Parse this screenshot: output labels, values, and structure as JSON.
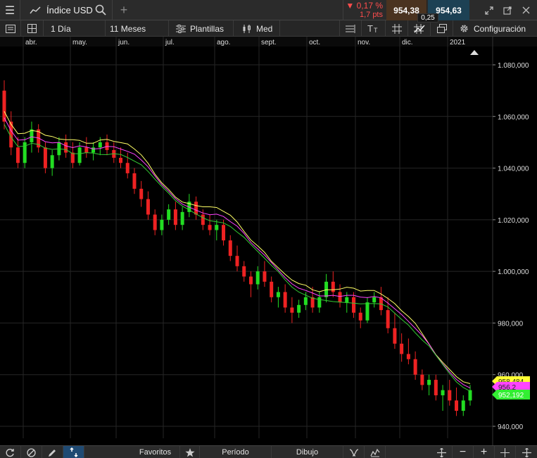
{
  "topbar": {
    "instrument": "Índice USD",
    "change_pct": "▼ 0,17 %",
    "change_pts": "1,7 pts",
    "bid": "954,38",
    "ask": "954,63",
    "spread": "0,25",
    "icons": [
      "menu-icon",
      "line-chart-icon",
      "search-icon",
      "plus-icon",
      "expand-icon",
      "popout-icon",
      "close-icon"
    ]
  },
  "toolbar": {
    "interval": "1 Día",
    "range": "11 Meses",
    "templates": "Plantillas",
    "price_type": "Med",
    "settings": "Configuración",
    "icons": [
      "panel-icon",
      "layout-icon",
      "templates-icon",
      "candles-icon",
      "indicators-icon",
      "text-size-icon",
      "grid-icon",
      "drawing-icon",
      "window-icon",
      "gear-icon"
    ]
  },
  "chart_data": {
    "type": "candlestick",
    "x_axis": [
      "abr.",
      "may.",
      "jun.",
      "jul.",
      "ago.",
      "sept.",
      "oct.",
      "nov.",
      "dic.",
      "2021"
    ],
    "y_ticks": [
      "1.080,000",
      "1.060,000",
      "1.040,000",
      "1.020,000",
      "1.000,000",
      "980,000",
      "960,000",
      "940,000"
    ],
    "ylim": [
      935,
      1085
    ],
    "price_labels": [
      {
        "text": "958,484",
        "color": "#ffff33"
      },
      {
        "text": "956,2",
        "color": "#ff44ff"
      },
      {
        "text": "952,192",
        "color": "#33ee33"
      }
    ],
    "colors": {
      "up": "#22dd22",
      "down": "#ee2222",
      "ma_fast": "#ffff66",
      "ma_mid": "#ff44ff",
      "ma_slow": "#33cc33"
    },
    "candles": [
      [
        1070,
        1074,
        1055,
        1058
      ],
      [
        1058,
        1062,
        1045,
        1048
      ],
      [
        1048,
        1052,
        1040,
        1042
      ],
      [
        1042,
        1052,
        1040,
        1050
      ],
      [
        1050,
        1058,
        1046,
        1055
      ],
      [
        1055,
        1057,
        1046,
        1048
      ],
      [
        1048,
        1050,
        1038,
        1040
      ],
      [
        1040,
        1047,
        1037,
        1045
      ],
      [
        1045,
        1052,
        1043,
        1050
      ],
      [
        1050,
        1053,
        1044,
        1046
      ],
      [
        1046,
        1050,
        1040,
        1042
      ],
      [
        1042,
        1050,
        1041,
        1048
      ],
      [
        1048,
        1052,
        1044,
        1046
      ],
      [
        1046,
        1050,
        1043,
        1048
      ],
      [
        1048,
        1052,
        1045,
        1050
      ],
      [
        1050,
        1053,
        1045,
        1047
      ],
      [
        1047,
        1050,
        1042,
        1044
      ],
      [
        1044,
        1048,
        1040,
        1042
      ],
      [
        1042,
        1046,
        1036,
        1038
      ],
      [
        1038,
        1040,
        1030,
        1032
      ],
      [
        1032,
        1035,
        1025,
        1028
      ],
      [
        1028,
        1031,
        1020,
        1022
      ],
      [
        1022,
        1024,
        1014,
        1016
      ],
      [
        1016,
        1022,
        1014,
        1020
      ],
      [
        1020,
        1026,
        1018,
        1024
      ],
      [
        1024,
        1027,
        1016,
        1018
      ],
      [
        1018,
        1025,
        1016,
        1023
      ],
      [
        1023,
        1030,
        1021,
        1027
      ],
      [
        1027,
        1029,
        1020,
        1022
      ],
      [
        1022,
        1024,
        1016,
        1018
      ],
      [
        1018,
        1022,
        1014,
        1016
      ],
      [
        1016,
        1020,
        1012,
        1018
      ],
      [
        1018,
        1020,
        1010,
        1012
      ],
      [
        1012,
        1014,
        1004,
        1006
      ],
      [
        1006,
        1010,
        1000,
        1002
      ],
      [
        1002,
        1004,
        996,
        998
      ],
      [
        998,
        1000,
        990,
        995
      ],
      [
        995,
        1002,
        993,
        1000
      ],
      [
        1000,
        1004,
        994,
        996
      ],
      [
        996,
        998,
        988,
        990
      ],
      [
        990,
        994,
        986,
        992
      ],
      [
        992,
        995,
        984,
        986
      ],
      [
        986,
        990,
        980,
        984
      ],
      [
        984,
        989,
        982,
        987
      ],
      [
        987,
        992,
        985,
        990
      ],
      [
        990,
        994,
        984,
        986
      ],
      [
        986,
        992,
        984,
        990
      ],
      [
        990,
        999,
        988,
        996
      ],
      [
        996,
        1000,
        990,
        992
      ],
      [
        992,
        995,
        986,
        988
      ],
      [
        988,
        992,
        984,
        990
      ],
      [
        990,
        992,
        982,
        984
      ],
      [
        984,
        986,
        978,
        981
      ],
      [
        981,
        990,
        980,
        988
      ],
      [
        988,
        992,
        986,
        990
      ],
      [
        990,
        994,
        983,
        985
      ],
      [
        985,
        990,
        976,
        978
      ],
      [
        978,
        984,
        970,
        972
      ],
      [
        972,
        976,
        965,
        968
      ],
      [
        968,
        974,
        964,
        966
      ],
      [
        966,
        969,
        958,
        960
      ],
      [
        960,
        962,
        954,
        956
      ],
      [
        956,
        960,
        952,
        958
      ],
      [
        958,
        960,
        950,
        952
      ],
      [
        952,
        956,
        946,
        954
      ],
      [
        954,
        958,
        948,
        950
      ],
      [
        950,
        955,
        944,
        946
      ],
      [
        946,
        952,
        944,
        950
      ],
      [
        950,
        956,
        948,
        954
      ]
    ]
  },
  "bottombar": {
    "favorites": "Favoritos",
    "period": "Período",
    "drawing": "Dibujo",
    "icons": [
      "refresh-icon",
      "no-entry-icon",
      "pencil-icon",
      "swap-icon",
      "star-icon",
      "fibonacci-icon",
      "trend-icon",
      "move-icon",
      "zoom-out-icon",
      "zoom-in-icon",
      "crosshair-icon",
      "resize-icon"
    ]
  }
}
